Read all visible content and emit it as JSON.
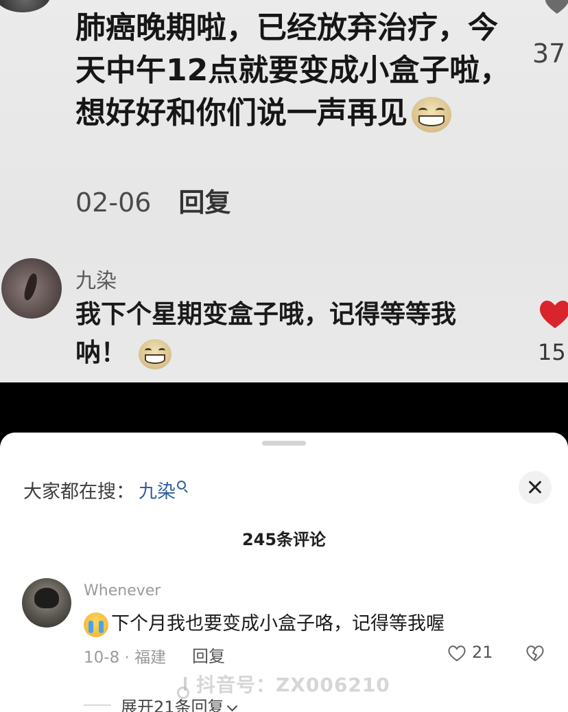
{
  "top_comment": {
    "text": "肺癌晚期啦，已经放弃治疗，今天中午12点就要变成小盒子啦，想好好和你们说一声再见",
    "date": "02-06",
    "reply_label": "回复",
    "like_count_partial": "37"
  },
  "reply_comment": {
    "author": "九染",
    "text": "我下个星期变盒子哦，记得等等我呐！",
    "like_count_partial": "15"
  },
  "sheet": {
    "search_prompt": "大家都在搜：",
    "search_keyword": "九染",
    "comment_count": "245条评论",
    "comment": {
      "author": "Whenever",
      "text": "下个月我也要变成小盒子咯，记得等我喔",
      "meta": "10-8 · 福建",
      "reply_label": "回复",
      "like_count": "21"
    },
    "watermark": "抖音号：ZX006210",
    "expand_label": "展开21条回复"
  },
  "colors": {
    "link": "#2f5f9e",
    "heart_red": "#d9242e"
  }
}
